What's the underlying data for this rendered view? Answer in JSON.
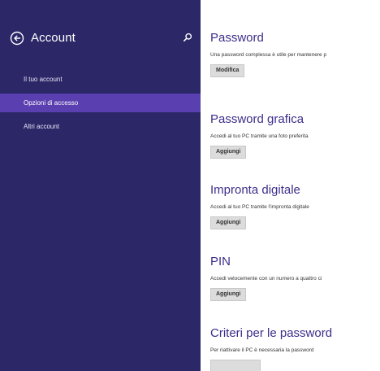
{
  "sidebar": {
    "title": "Account",
    "items": [
      {
        "label": "Il tuo account"
      },
      {
        "label": "Opzioni di accesso"
      },
      {
        "label": "Altri account"
      }
    ]
  },
  "sections": [
    {
      "title": "Password",
      "description": "Una password complessa è utile per mantenere p",
      "button": "Modifica"
    },
    {
      "title": "Password grafica",
      "description": "Accedi al tuo PC tramite una foto preferita",
      "button": "Aggiungi"
    },
    {
      "title": "Impronta digitale",
      "description": "Accedi al tuo PC tramite l'impronta digitale",
      "button": "Aggiungi"
    },
    {
      "title": "PIN",
      "description": "Accedi velocemente con un numero a quattro ci",
      "button": "Aggiungi"
    },
    {
      "title": "Criteri per le password",
      "description": "Per riattivare il PC è necessaria la password",
      "button": ""
    }
  ],
  "colors": {
    "sidebar_bg": "#2c2767",
    "selected_bg": "#5a3fb0",
    "heading": "#3d2e8a"
  },
  "icons": {
    "back": "back-arrow-circle-icon",
    "search": "search-icon"
  }
}
